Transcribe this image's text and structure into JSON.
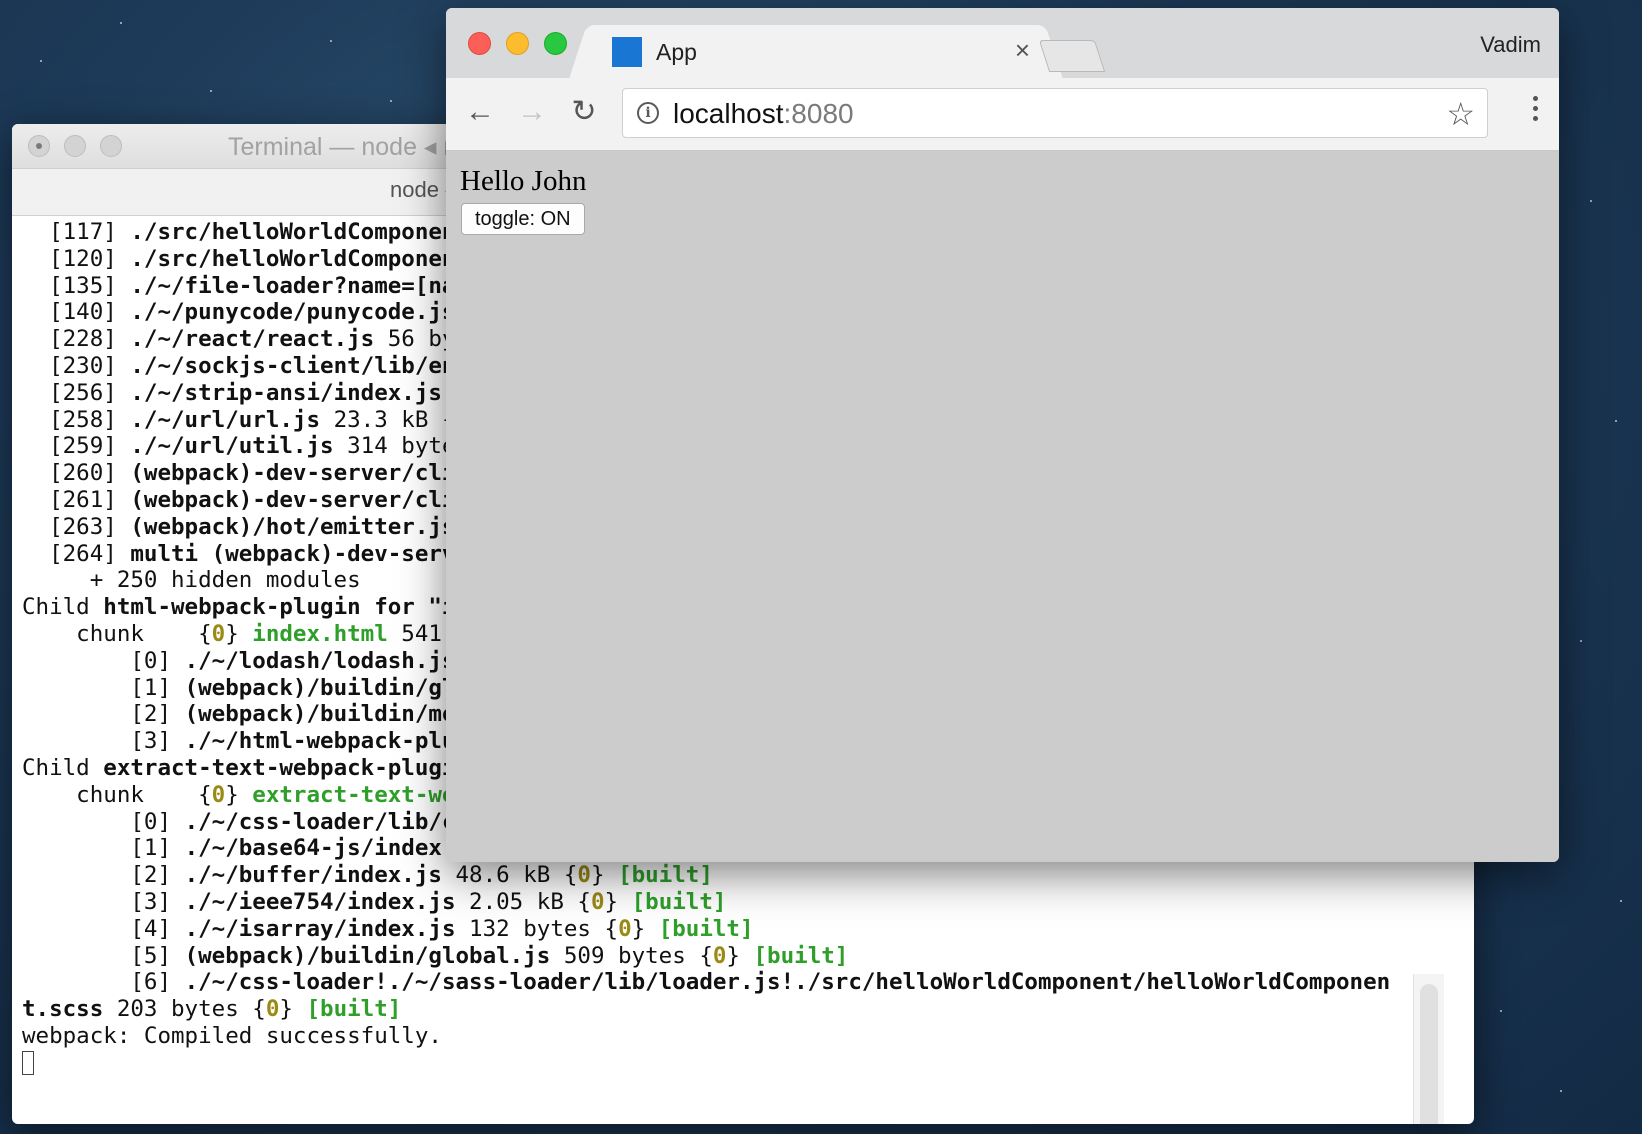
{
  "terminal": {
    "title": "Terminal — node ◂ n",
    "tab_label": "node ◂",
    "lines": [
      [
        {
          "t": "  [117] "
        },
        {
          "t": "./src/helloWorldComponen",
          "c": "b"
        }
      ],
      [
        {
          "t": "  [120] "
        },
        {
          "t": "./src/helloWorldComponen",
          "c": "b"
        }
      ],
      [
        {
          "t": "  [135] "
        },
        {
          "t": "./~/file-loader?name=[na",
          "c": "b"
        }
      ],
      [
        {
          "t": "  [140] "
        },
        {
          "t": "./~/punycode/punycode.js",
          "c": "b"
        }
      ],
      [
        {
          "t": "  [228] "
        },
        {
          "t": "./~/react/react.js",
          "c": "b"
        },
        {
          "t": " 56 by"
        }
      ],
      [
        {
          "t": "  [230] "
        },
        {
          "t": "./~/sockjs-client/lib/en",
          "c": "b"
        }
      ],
      [
        {
          "t": "  [256] "
        },
        {
          "t": "./~/strip-ansi/index.js",
          "c": "b"
        }
      ],
      [
        {
          "t": "  [258] "
        },
        {
          "t": "./~/url/url.js",
          "c": "b"
        },
        {
          "t": " 23.3 kB {"
        }
      ],
      [
        {
          "t": "  [259] "
        },
        {
          "t": "./~/url/util.js",
          "c": "b"
        },
        {
          "t": " 314 byte"
        }
      ],
      [
        {
          "t": "  [260] "
        },
        {
          "t": "(webpack)-dev-server/cli",
          "c": "b"
        }
      ],
      [
        {
          "t": "  [261] "
        },
        {
          "t": "(webpack)-dev-server/cli",
          "c": "b"
        }
      ],
      [
        {
          "t": "  [263] "
        },
        {
          "t": "(webpack)/hot/emitter.js",
          "c": "b"
        }
      ],
      [
        {
          "t": "  [264] "
        },
        {
          "t": "multi (webpack)-dev-serv",
          "c": "b"
        }
      ],
      [
        {
          "t": "     + 250 hidden modules"
        }
      ],
      [
        {
          "t": "Child "
        },
        {
          "t": "html-webpack-plugin for \"i",
          "c": "b"
        }
      ],
      [
        {
          "t": "    chunk    {"
        },
        {
          "t": "0",
          "c": "y"
        },
        {
          "t": "} "
        },
        {
          "t": "index.html",
          "c": "g"
        },
        {
          "t": " 541"
        }
      ],
      [
        {
          "t": "        [0] "
        },
        {
          "t": "./~/lodash/lodash.js",
          "c": "b"
        }
      ],
      [
        {
          "t": "        [1] "
        },
        {
          "t": "(webpack)/buildin/gl",
          "c": "b"
        }
      ],
      [
        {
          "t": "        [2] "
        },
        {
          "t": "(webpack)/buildin/mo",
          "c": "b"
        }
      ],
      [
        {
          "t": "        [3] "
        },
        {
          "t": "./~/html-webpack-plu",
          "c": "b"
        }
      ],
      [
        {
          "t": "Child "
        },
        {
          "t": "extract-text-webpack-plugi",
          "c": "b"
        }
      ],
      [
        {
          "t": "    chunk    {"
        },
        {
          "t": "0",
          "c": "y"
        },
        {
          "t": "} "
        },
        {
          "t": "extract-text-we",
          "c": "g"
        }
      ],
      [
        {
          "t": "        [0] "
        },
        {
          "t": "./~/css-loader/lib/c",
          "c": "b"
        }
      ],
      [
        {
          "t": "        [1] "
        },
        {
          "t": "./~/base64-js/index.",
          "c": "b"
        }
      ],
      [
        {
          "t": "        [2] "
        },
        {
          "t": "./~/buffer/index.js",
          "c": "b"
        },
        {
          "t": " 48.6 kB {"
        },
        {
          "t": "0",
          "c": "y"
        },
        {
          "t": "} "
        },
        {
          "t": "[built]",
          "c": "g"
        }
      ],
      [
        {
          "t": "        [3] "
        },
        {
          "t": "./~/ieee754/index.js",
          "c": "b"
        },
        {
          "t": " 2.05 kB {"
        },
        {
          "t": "0",
          "c": "y"
        },
        {
          "t": "} "
        },
        {
          "t": "[built]",
          "c": "g"
        }
      ],
      [
        {
          "t": "        [4] "
        },
        {
          "t": "./~/isarray/index.js",
          "c": "b"
        },
        {
          "t": " 132 bytes {"
        },
        {
          "t": "0",
          "c": "y"
        },
        {
          "t": "} "
        },
        {
          "t": "[built]",
          "c": "g"
        }
      ],
      [
        {
          "t": "        [5] "
        },
        {
          "t": "(webpack)/buildin/global.js",
          "c": "b"
        },
        {
          "t": " 509 bytes {"
        },
        {
          "t": "0",
          "c": "y"
        },
        {
          "t": "} "
        },
        {
          "t": "[built]",
          "c": "g"
        }
      ],
      [
        {
          "t": "        [6] "
        },
        {
          "t": "./~/css-loader!./~/sass-loader/lib/loader.js!./src/helloWorldComponent/helloWorldComponen",
          "c": "b"
        }
      ],
      [
        {
          "t": "t.scss",
          "c": "b"
        },
        {
          "t": " 203 bytes {"
        },
        {
          "t": "0",
          "c": "y"
        },
        {
          "t": "} "
        },
        {
          "t": "[built]",
          "c": "g"
        }
      ],
      [
        {
          "t": "webpack: Compiled successfully."
        }
      ]
    ]
  },
  "browser": {
    "tab_title": "App",
    "tab_close": "×",
    "profile_name": "Vadim",
    "url_host": "localhost",
    "url_port": ":8080",
    "page": {
      "greeting": "Hello John",
      "toggle_label": "toggle: ON"
    },
    "favicon_color": "#1976d2"
  }
}
